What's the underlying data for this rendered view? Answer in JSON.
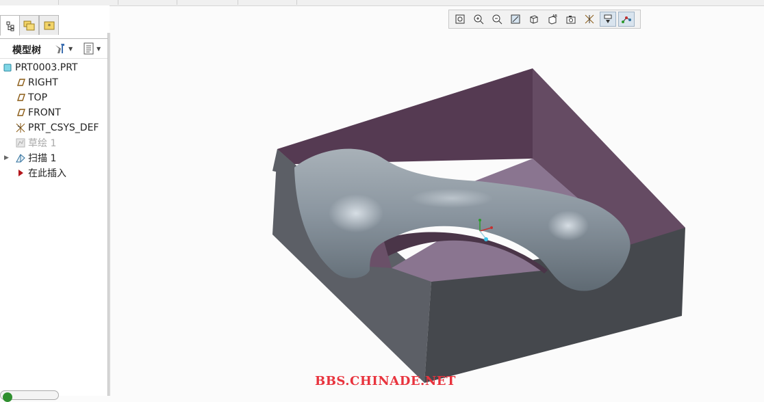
{
  "panel": {
    "title": "模型树",
    "tabs": [
      {
        "name": "model-tree-tab",
        "icon": "tree-icon"
      },
      {
        "name": "folder-browser-tab",
        "icon": "folders-icon"
      },
      {
        "name": "favorites-tab",
        "icon": "favorites-icon"
      }
    ],
    "header_buttons": [
      {
        "icon": "settings-tools-icon"
      },
      {
        "icon": "show-list-icon"
      }
    ]
  },
  "tree": {
    "items": [
      {
        "label": "PRT0003.PRT",
        "icon": "part-icon",
        "indent": 0,
        "dim": false,
        "expander": false
      },
      {
        "label": "RIGHT",
        "icon": "datum-plane-icon",
        "indent": 1,
        "dim": false,
        "expander": false
      },
      {
        "label": "TOP",
        "icon": "datum-plane-icon",
        "indent": 1,
        "dim": false,
        "expander": false
      },
      {
        "label": "FRONT",
        "icon": "datum-plane-icon",
        "indent": 1,
        "dim": false,
        "expander": false
      },
      {
        "label": "PRT_CSYS_DEF",
        "icon": "coordinate-system-icon",
        "indent": 1,
        "dim": false,
        "expander": false
      },
      {
        "label": "草绘 1",
        "icon": "sketch-icon",
        "indent": 1,
        "dim": true,
        "expander": false
      },
      {
        "label": "扫描 1",
        "icon": "sweep-icon",
        "indent": 1,
        "dim": false,
        "expander": true
      },
      {
        "label": "在此插入",
        "icon": "insert-here-arrow-icon",
        "indent": 1,
        "dim": false,
        "expander": false
      }
    ]
  },
  "view_toolbar": {
    "buttons": [
      {
        "icon": "refit-icon",
        "pressed": false
      },
      {
        "icon": "zoom-in-icon",
        "pressed": false
      },
      {
        "icon": "zoom-out-icon",
        "pressed": false
      },
      {
        "icon": "repaint-icon",
        "pressed": false
      },
      {
        "icon": "display-style-icon",
        "pressed": false
      },
      {
        "icon": "saved-orientations-icon",
        "pressed": false
      },
      {
        "icon": "view-manager-icon",
        "pressed": false
      },
      {
        "icon": "datum-display-filters-icon",
        "pressed": false
      },
      {
        "icon": "annotation-display-icon",
        "pressed": true
      },
      {
        "icon": "spin-center-icon",
        "pressed": true
      }
    ]
  },
  "watermark": "BBS.CHINADE.NET",
  "colors": {
    "cavity_wall": "#5a3c55",
    "cavity_floor": "#8a7590",
    "block_side_left": "#5c5f66",
    "block_side_front": "#45484d",
    "sweep_surface": "#8f9aa3",
    "watermark": "#e8333d"
  }
}
